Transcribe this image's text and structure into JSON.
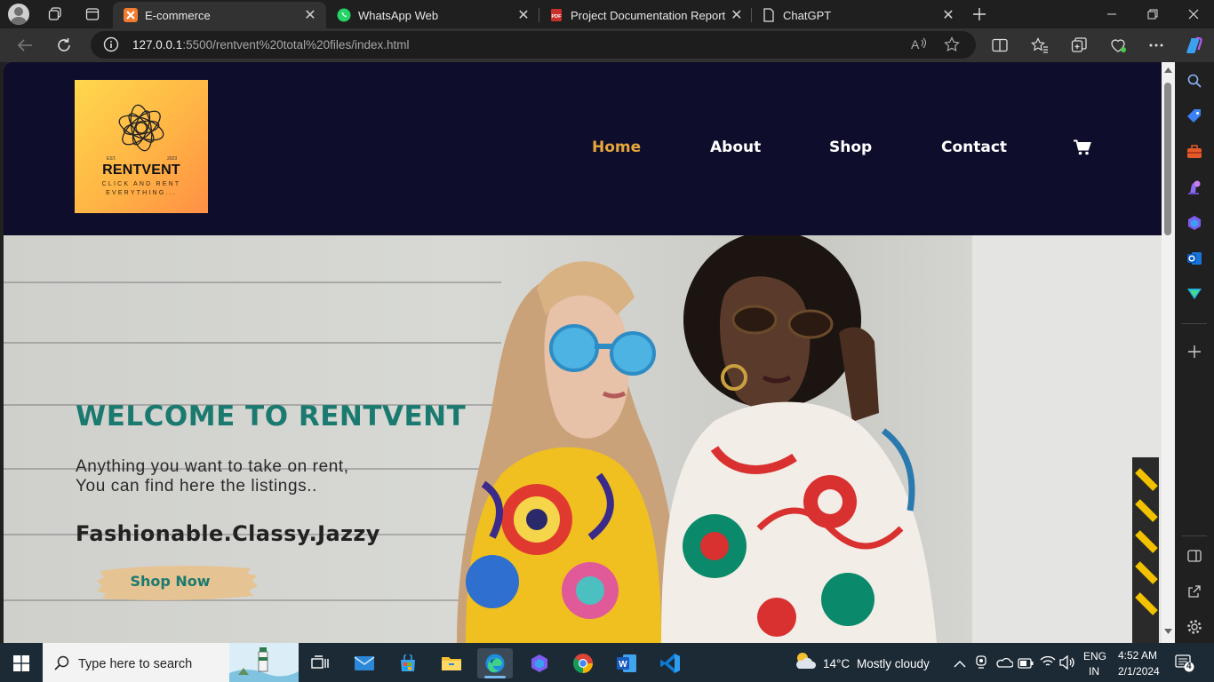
{
  "tabs": [
    {
      "title": "E-commerce",
      "icon": "xampp-icon"
    },
    {
      "title": "WhatsApp Web",
      "icon": "whatsapp-icon"
    },
    {
      "title": "Project Documentation Report Re",
      "icon": "pdf-icon"
    },
    {
      "title": "ChatGPT",
      "icon": "page-icon"
    }
  ],
  "address": {
    "host": "127.0.0.1",
    "rest": ":5500/rentvent%20total%20files/index.html"
  },
  "site": {
    "logo": {
      "est": "EST.",
      "year": "2023",
      "name": "RENTVENT",
      "tagline": "CLICK AND RENT EVERYTHING..."
    },
    "nav": [
      "Home",
      "About",
      "Shop",
      "Contact"
    ],
    "hero": {
      "title": "WELCOME TO RENTVENT",
      "sub_line1": "Anything you want to take on rent,",
      "sub_line2": "You can find here the listings..",
      "slogan": "Fashionable.Classy.Jazzy",
      "cta": "Shop Now"
    }
  },
  "colors": {
    "header_bg": "#0e0e2c",
    "accent_teal": "#1b7a6f",
    "nav_active": "#e6a63a",
    "logo_bg": "#ffb445"
  },
  "taskbar": {
    "search_placeholder": "Type here to search",
    "weather_temp": "14°C",
    "weather_text": "Mostly cloudy",
    "lang_1": "ENG",
    "lang_2": "IN",
    "time": "4:52 AM",
    "date": "2/1/2024",
    "notifications": "4"
  }
}
